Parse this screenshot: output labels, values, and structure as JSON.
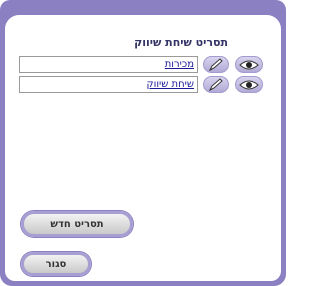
{
  "title": "תסריט שיחת שיווק",
  "rows": [
    {
      "name": "מכירות",
      "edit_icon": "pencil-icon",
      "view_icon": "eye-icon"
    },
    {
      "name": "שיחת שיווק",
      "edit_icon": "pencil-icon",
      "view_icon": "eye-icon"
    }
  ],
  "buttons": {
    "new_script": "תסריט חדש",
    "close": "סגור"
  },
  "colors": {
    "frame": "#8b80c2",
    "title": "#333366",
    "link": "#1a1a99",
    "button_border": "#a79ed2"
  }
}
